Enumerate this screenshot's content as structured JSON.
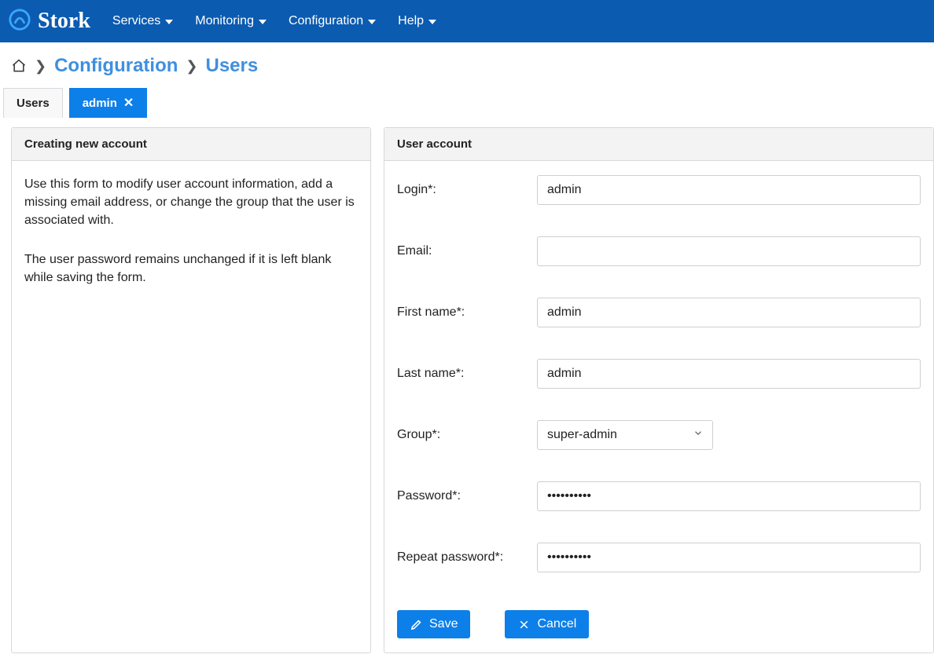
{
  "brand": "Stork",
  "nav": {
    "services": "Services",
    "monitoring": "Monitoring",
    "configuration": "Configuration",
    "help": "Help"
  },
  "breadcrumb": {
    "configuration": "Configuration",
    "users": "Users"
  },
  "tabs": {
    "users": "Users",
    "admin": "admin"
  },
  "left": {
    "title": "Creating new account",
    "p1": "Use this form to modify user account information, add a missing email address, or change the group that the user is associated with.",
    "p2": "The user password remains unchanged if it is left blank while saving the form."
  },
  "right": {
    "title": "User account",
    "labels": {
      "login": "Login*:",
      "email": "Email:",
      "first": "First name*:",
      "last": "Last name*:",
      "group": "Group*:",
      "password": "Password*:",
      "repeat": "Repeat password*:"
    },
    "values": {
      "login": "admin",
      "email": "",
      "first": "admin",
      "last": "admin",
      "group": "super-admin",
      "password": "••••••••••",
      "repeat": "••••••••••"
    },
    "buttons": {
      "save": "Save",
      "cancel": "Cancel"
    }
  }
}
